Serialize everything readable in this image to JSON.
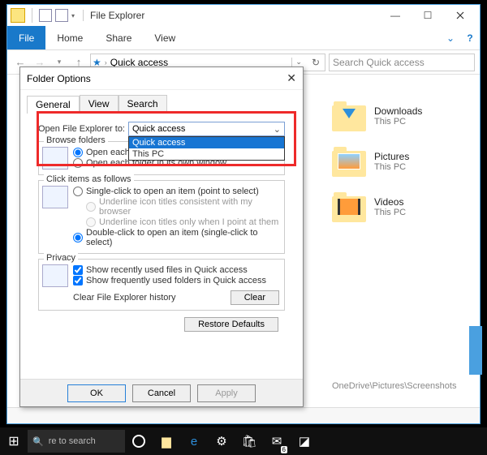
{
  "window": {
    "title": "File Explorer",
    "ribbon": {
      "file": "File",
      "home": "Home",
      "share": "Share",
      "view": "View"
    },
    "address": {
      "label": "Quick access"
    },
    "search_placeholder": "Search Quick access"
  },
  "folders": [
    {
      "name": "Downloads",
      "loc": "This PC",
      "kind": "dl"
    },
    {
      "name": "Pictures",
      "loc": "This PC",
      "kind": "pic"
    },
    {
      "name": "Videos",
      "loc": "This PC",
      "kind": "vid"
    }
  ],
  "path_label": "OneDrive\\Pictures\\Screenshots",
  "dialog": {
    "title": "Folder Options",
    "tabs": {
      "general": "General",
      "view": "View",
      "search": "Search"
    },
    "open_to_label": "Open File Explorer to:",
    "combo_value": "Quick access",
    "combo_options": [
      "Quick access",
      "This PC"
    ],
    "browse_legend": "Browse folders",
    "browse_same": "Open each folder in the same window",
    "browse_own": "Open each folder in its own window",
    "click_legend": "Click items as follows",
    "click_single": "Single-click to open an item (point to select)",
    "click_ul_browser": "Underline icon titles consistent with my browser",
    "click_ul_point": "Underline icon titles only when I point at them",
    "click_double": "Double-click to open an item (single-click to select)",
    "privacy_legend": "Privacy",
    "priv_recent": "Show recently used files in Quick access",
    "priv_freq": "Show frequently used folders in Quick access",
    "clear_label": "Clear File Explorer history",
    "clear_btn": "Clear",
    "restore_btn": "Restore Defaults",
    "ok": "OK",
    "cancel": "Cancel",
    "apply": "Apply"
  },
  "taskbar": {
    "search_placeholder": "re to search",
    "mail_badge": "6"
  }
}
